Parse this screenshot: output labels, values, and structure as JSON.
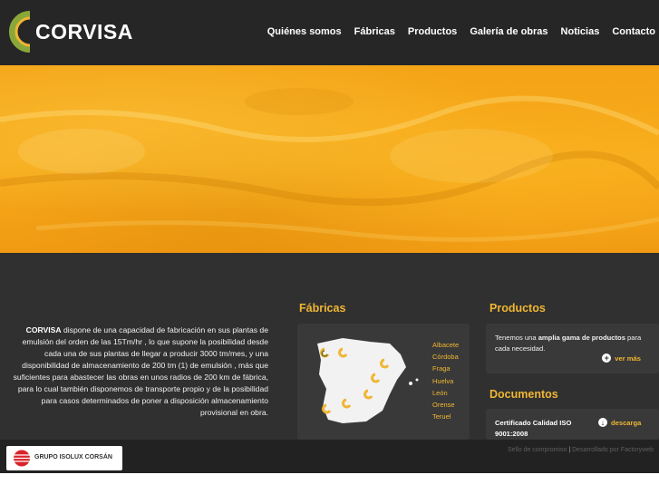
{
  "brand": {
    "name": "CORVISA",
    "colors": {
      "accent": "#f0b633",
      "hero": "#f4a316",
      "background": "#2b2b2b"
    }
  },
  "nav": [
    {
      "label": "Quiénes somos"
    },
    {
      "label": "Fábricas"
    },
    {
      "label": "Productos"
    },
    {
      "label": "Galería de obras"
    },
    {
      "label": "Noticias"
    },
    {
      "label": "Contacto"
    }
  ],
  "intro": {
    "bold": "CORVISA",
    "text": " dispone de una capacidad de fabricación en sus plantas de emulsión del orden de las 15Tm/hr , lo que supone la posibilidad desde cada una de sus plantas de llegar a producir 3000 tm/mes, y una disponibilidad de almacenamiento de 200 tm (1) de emulsión , más que suficientes para abastecer las obras en unos radios de 200 km de fábrica, para lo cual también disponemos de transporte propio y de la posibilidad para casos determinados de poner a disposición almacenamiento provisional en obra."
  },
  "fabricas": {
    "title": "Fábricas",
    "map_icon": "spain-map",
    "items": [
      "Albacete",
      "Córdoba",
      "Fraga",
      "Huelva",
      "León",
      "Orense",
      "Teruel"
    ]
  },
  "productos": {
    "title": "Productos",
    "text_before": "Tenemos una ",
    "text_bold": "amplia gama de productos",
    "text_after": " para cada necesidad.",
    "link": "ver más",
    "link_icon": "plus-circle-icon"
  },
  "documentos": {
    "title": "Documentos",
    "item": "Certificado Calidad ISO 9001:2008",
    "link": "descarga",
    "link_icon": "download-circle-icon"
  },
  "footer": {
    "sponsor": "GRUPO ISOLUX CORSÁN",
    "link1": "Sello de compromiso",
    "separator": "|",
    "link2": "Desarrollado por Factoryweb"
  }
}
